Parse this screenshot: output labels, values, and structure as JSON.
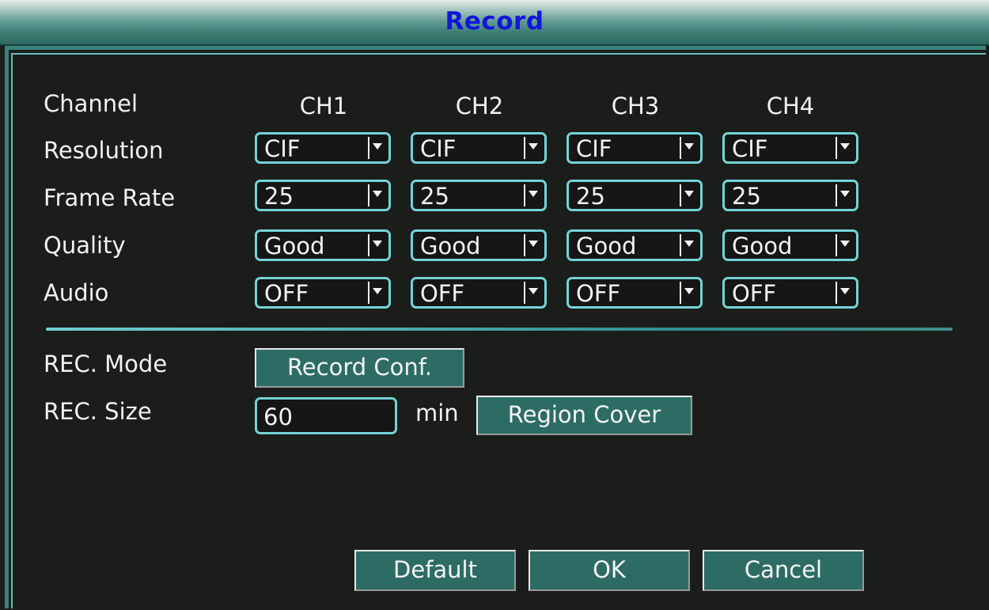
{
  "window": {
    "title": "Record"
  },
  "row_labels": {
    "channel": "Channel",
    "resolution": "Resolution",
    "frame_rate": "Frame Rate",
    "quality": "Quality",
    "audio": "Audio"
  },
  "channels": [
    {
      "label": "CH1",
      "resolution": "CIF",
      "frame_rate": "25",
      "quality": "Good",
      "audio": "OFF"
    },
    {
      "label": "CH2",
      "resolution": "CIF",
      "frame_rate": "25",
      "quality": "Good",
      "audio": "OFF"
    },
    {
      "label": "CH3",
      "resolution": "CIF",
      "frame_rate": "25",
      "quality": "Good",
      "audio": "OFF"
    },
    {
      "label": "CH4",
      "resolution": "CIF",
      "frame_rate": "25",
      "quality": "Good",
      "audio": "OFF"
    }
  ],
  "rec_mode": {
    "label": "REC. Mode",
    "button": "Record Conf."
  },
  "rec_size": {
    "label": "REC. Size",
    "value": "60",
    "unit": "min"
  },
  "region_cover": {
    "button": "Region Cover"
  },
  "footer": {
    "default": "Default",
    "ok": "OK",
    "cancel": "Cancel"
  },
  "colors": {
    "accent": "#73d3d6",
    "button_bg": "#2d6c64",
    "title_text": "#1216d9",
    "background": "#1b1d1b"
  }
}
